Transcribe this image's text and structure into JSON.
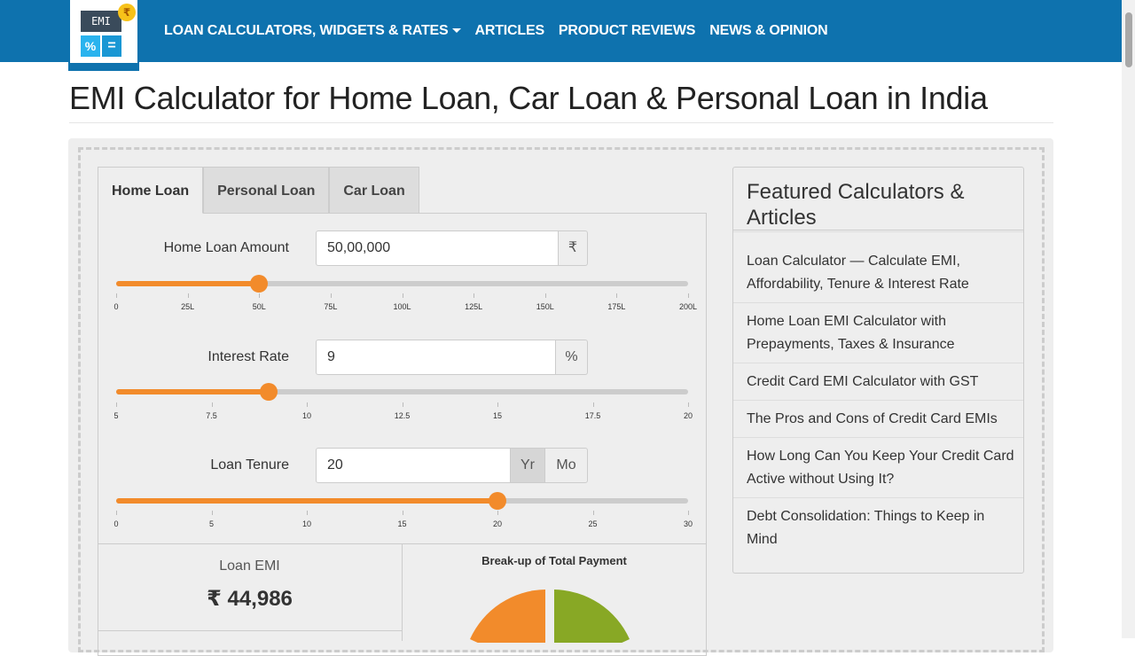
{
  "nav": {
    "logo": {
      "screen": "EMI",
      "coin": "₹",
      "key1": "%",
      "key2": "="
    },
    "links": [
      "LOAN CALCULATORS, WIDGETS & RATES",
      "ARTICLES",
      "PRODUCT REVIEWS",
      "NEWS & OPINION"
    ]
  },
  "page": {
    "title": "EMI Calculator for Home Loan, Car Loan & Personal Loan in India"
  },
  "tabs": [
    "Home Loan",
    "Personal Loan",
    "Car Loan"
  ],
  "fields": {
    "amount": {
      "label": "Home Loan Amount",
      "value": "50,00,000",
      "unit": "₹",
      "slider_fraction": 0.25,
      "ticks": [
        "0",
        "25L",
        "50L",
        "75L",
        "100L",
        "125L",
        "150L",
        "175L",
        "200L"
      ]
    },
    "rate": {
      "label": "Interest Rate",
      "value": "9",
      "unit": "%",
      "slider_fraction": 0.2667,
      "ticks": [
        "5",
        "7.5",
        "10",
        "12.5",
        "15",
        "17.5",
        "20"
      ]
    },
    "tenure": {
      "label": "Loan Tenure",
      "value": "20",
      "unit_year": "Yr",
      "unit_month": "Mo",
      "slider_fraction": 0.6667,
      "ticks": [
        "0",
        "5",
        "10",
        "15",
        "20",
        "25",
        "30"
      ]
    }
  },
  "results": {
    "emi_label": "Loan EMI",
    "emi_value": "₹ 44,986",
    "chart_title": "Break-up of Total Payment"
  },
  "colors": {
    "nav": "#0e72ae",
    "accent": "#f28b2b",
    "interest_slice": "#f28b2b",
    "principal_slice": "#88a825"
  },
  "sidebar": {
    "title": "Featured Calculators & Articles",
    "items": [
      "Loan Calculator — Calculate EMI, Affordability, Tenure & Interest Rate",
      "Home Loan EMI Calculator with Prepayments, Taxes & Insurance",
      "Credit Card EMI Calculator with GST",
      "The Pros and Cons of Credit Card EMIs",
      "How Long Can You Keep Your Credit Card Active without Using It?",
      "Debt Consolidation: Things to Keep in Mind"
    ]
  }
}
